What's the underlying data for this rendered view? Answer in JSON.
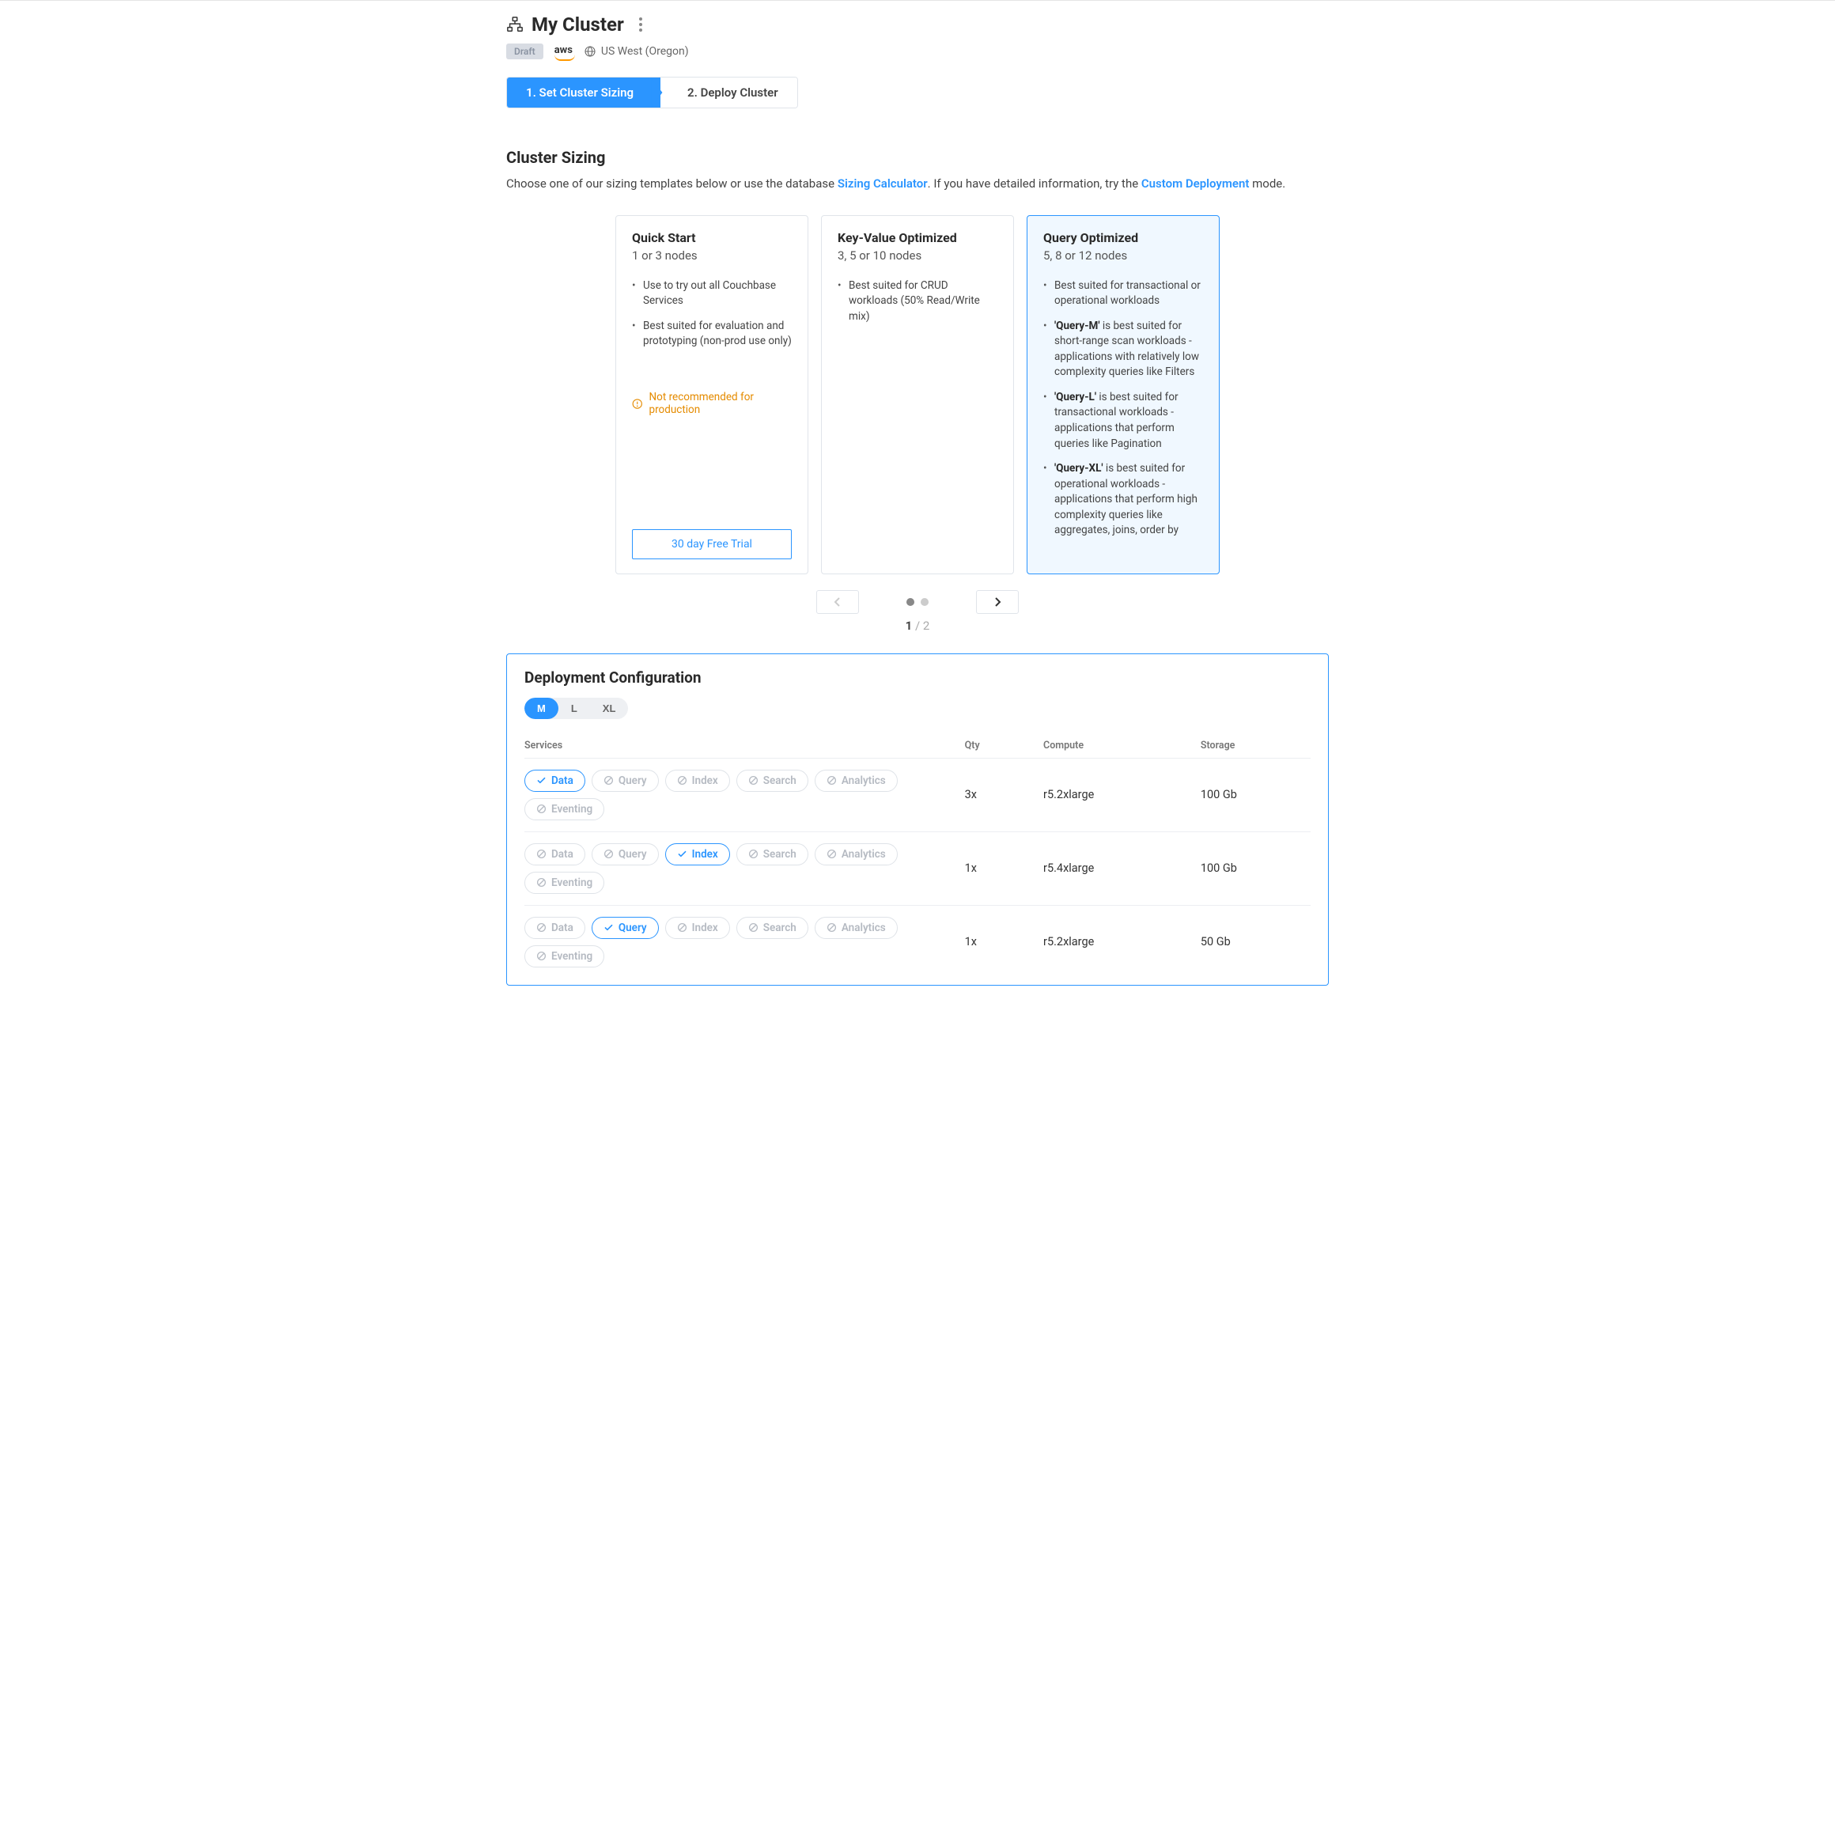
{
  "header": {
    "title": "My Cluster",
    "draft_badge": "Draft",
    "provider": "aws",
    "region": "US West (Oregon)"
  },
  "steps": {
    "one": "1. Set Cluster Sizing",
    "two": "2. Deploy Cluster"
  },
  "sizing": {
    "title": "Cluster Sizing",
    "sub_pre": "Choose one of our sizing templates below or use the database ",
    "link1": "Sizing Calculator",
    "sub_mid": ". If you have detailed information, try the ",
    "link2": "Custom Deployment",
    "sub_post": " mode."
  },
  "cards": {
    "quick": {
      "title": "Quick Start",
      "nodes": "1 or 3 nodes",
      "b1": "Use to try out all Couchbase Services",
      "b2": "Best suited for evaluation and prototyping (non-prod use only)",
      "warn": "Not recommended for production",
      "trial": "30 day Free Trial"
    },
    "kv": {
      "title": "Key-Value Optimized",
      "nodes": "3, 5 or 10 nodes",
      "b1": "Best suited for CRUD workloads (50% Read/Write mix)"
    },
    "query": {
      "title": "Query Optimized",
      "nodes": "5, 8 or 12 nodes",
      "b1": "Best suited for transactional or operational workloads",
      "b2_strong": "'Query-M'",
      "b2_rest": " is best suited for short-range scan workloads - applications with relatively low complexity queries like Filters",
      "b3_strong": "'Query-L'",
      "b3_rest": " is best suited for transactional workloads - applications that perform queries like Pagination",
      "b4_strong": "'Query-XL'",
      "b4_rest": " is best suited for operational workloads - applications that perform high complexity queries like aggregates, joins, order by"
    }
  },
  "pager": {
    "current": "1",
    "sep": " / ",
    "total": "2"
  },
  "deploy": {
    "title": "Deployment Configuration",
    "sizes": {
      "m": "M",
      "l": "L",
      "xl": "XL"
    },
    "cols": {
      "services": "Services",
      "qty": "Qty",
      "compute": "Compute",
      "storage": "Storage"
    },
    "svc": {
      "data": "Data",
      "query": "Query",
      "index": "Index",
      "search": "Search",
      "analytics": "Analytics",
      "eventing": "Eventing"
    },
    "rows": [
      {
        "qty": "3x",
        "compute": "r5.2xlarge",
        "storage": "100 Gb"
      },
      {
        "qty": "1x",
        "compute": "r5.4xlarge",
        "storage": "100 Gb"
      },
      {
        "qty": "1x",
        "compute": "r5.2xlarge",
        "storage": "50 Gb"
      }
    ]
  }
}
